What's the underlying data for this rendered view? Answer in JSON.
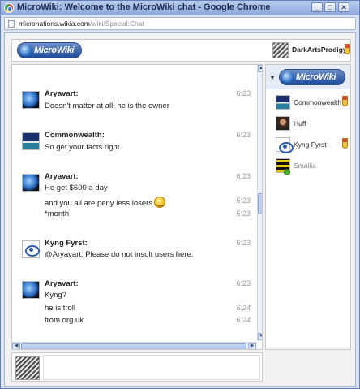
{
  "window": {
    "title": "MicroWiki: Welcome to the MicroWiki chat - Google Chrome",
    "controls": {
      "minimize": "_",
      "maximize": "□",
      "close": "✕"
    }
  },
  "address": {
    "host": "micronations.wikia.com",
    "path": "/wiki/Special:Chat"
  },
  "header": {
    "logo_text": "MicroWiki",
    "current_user": "DarkArtsProdigy"
  },
  "messages": [
    {
      "author": "Aryavart:",
      "avatar": "earth",
      "lines": [
        {
          "text": "Doesn't matter at all. he is the owner",
          "time": "6:23"
        }
      ]
    },
    {
      "author": "Commonwealth:",
      "avatar": "flag",
      "lines": [
        {
          "text": "So get your facts right.",
          "time": "6:23"
        }
      ]
    },
    {
      "author": "Aryavart:",
      "avatar": "earth",
      "lines": [
        {
          "text": "He get $600 a day",
          "time": "6:23"
        },
        {
          "text": "and you all are peny less losers",
          "time": "6:23",
          "emoji": "smiley"
        },
        {
          "text": "*month",
          "time": "6:23"
        }
      ]
    },
    {
      "author": "Kyng Fyrst:",
      "avatar": "kyng",
      "lines": [
        {
          "text": "@Aryavart: Please do not insult users here.",
          "time": "6:23"
        }
      ]
    },
    {
      "author": "Aryavart:",
      "avatar": "earth",
      "lines": [
        {
          "text": "Kyng?",
          "time": "6:23"
        },
        {
          "text": "he is troll",
          "time": "6:24"
        },
        {
          "text": "from org.uk",
          "time": "6:24"
        }
      ]
    }
  ],
  "userlist": {
    "room_logo_text": "MicroWiki",
    "users": [
      {
        "name": "Commonwealth",
        "status": "online",
        "badge": "chat-moderator"
      },
      {
        "name": "Huff",
        "status": "online",
        "badge": ""
      },
      {
        "name": "Kyng Fyrst",
        "status": "online",
        "badge": "chat-moderator"
      },
      {
        "name": "Smallia",
        "status": "away",
        "badge": ""
      }
    ]
  },
  "input": {
    "value": "",
    "placeholder": ""
  },
  "colors": {
    "accent": "#1e4a99",
    "chrome_blue": "#8fa9dc",
    "timestamp": "#999999"
  }
}
